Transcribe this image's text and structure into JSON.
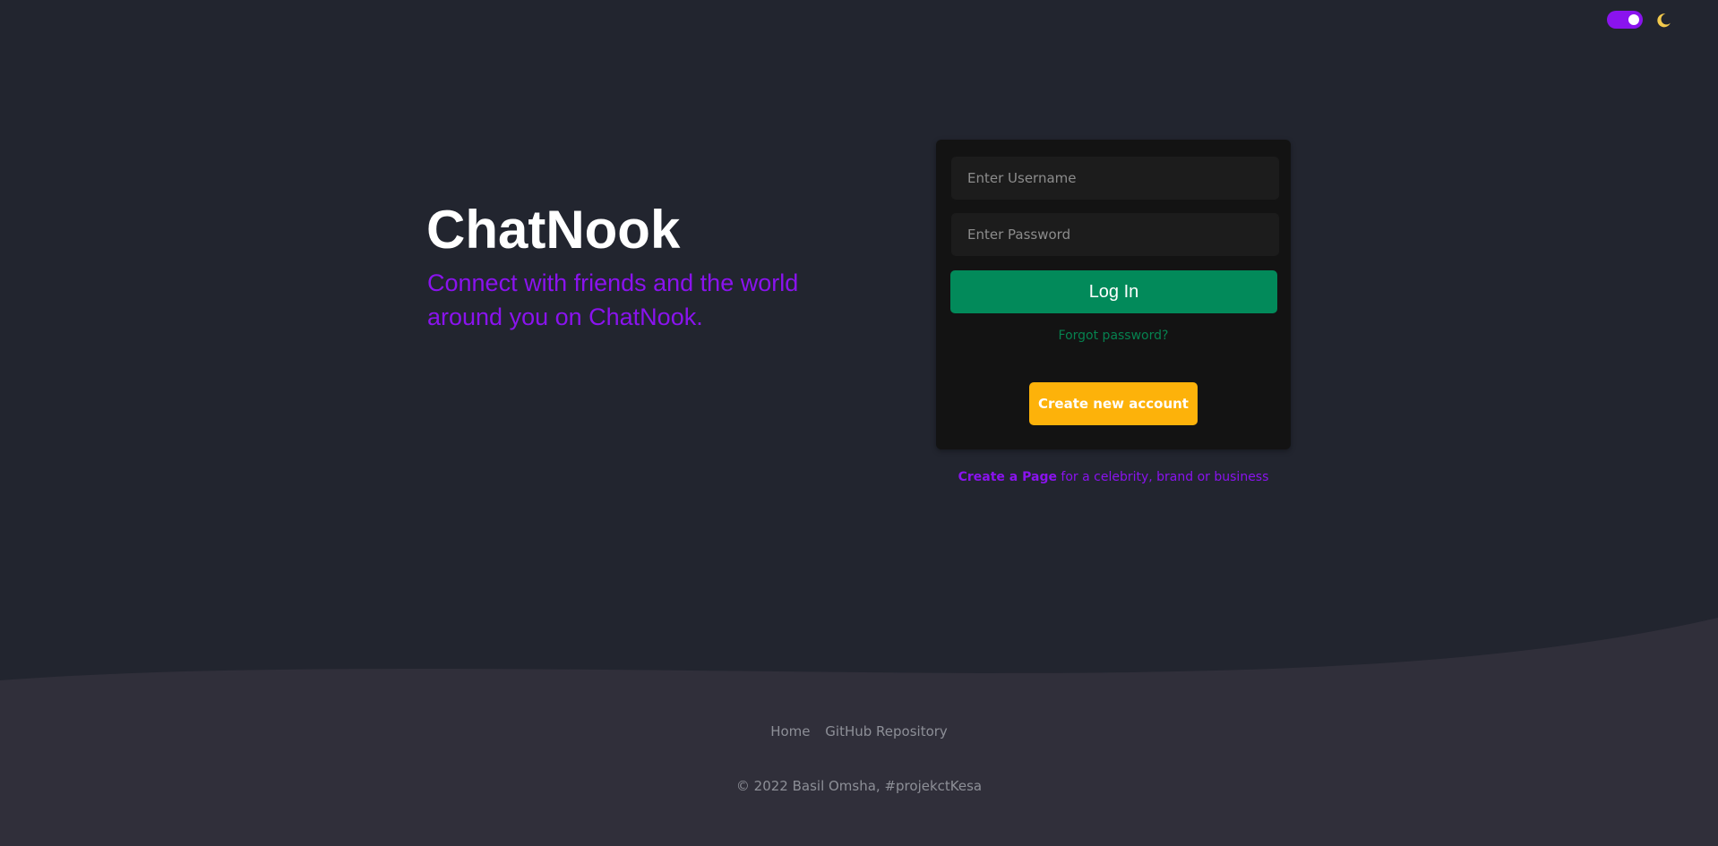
{
  "app": {
    "title": "ChatNook",
    "tagline": "Connect with friends and the world around you on ChatNook."
  },
  "theme": {
    "dark_mode_enabled": true,
    "toggle_icon": "toggle-on-icon",
    "mode_icon": "moon-icon",
    "accent_color": "#8a13ee",
    "moon_color": "#f2c94c"
  },
  "login": {
    "username_placeholder": "Enter Username",
    "password_placeholder": "Enter Password",
    "login_label": "Log In",
    "forgot_label": "Forgot password?",
    "create_account_label": "Create new account",
    "login_color": "#028a5a",
    "create_color": "#fdb20a"
  },
  "create_page": {
    "link_label": "Create a Page",
    "suffix": " for a celebrity, brand or business"
  },
  "footer": {
    "links": [
      "Home",
      "GitHub Repository"
    ],
    "copyright": "© 2022 Basil Omsha, #projekctKesa"
  }
}
